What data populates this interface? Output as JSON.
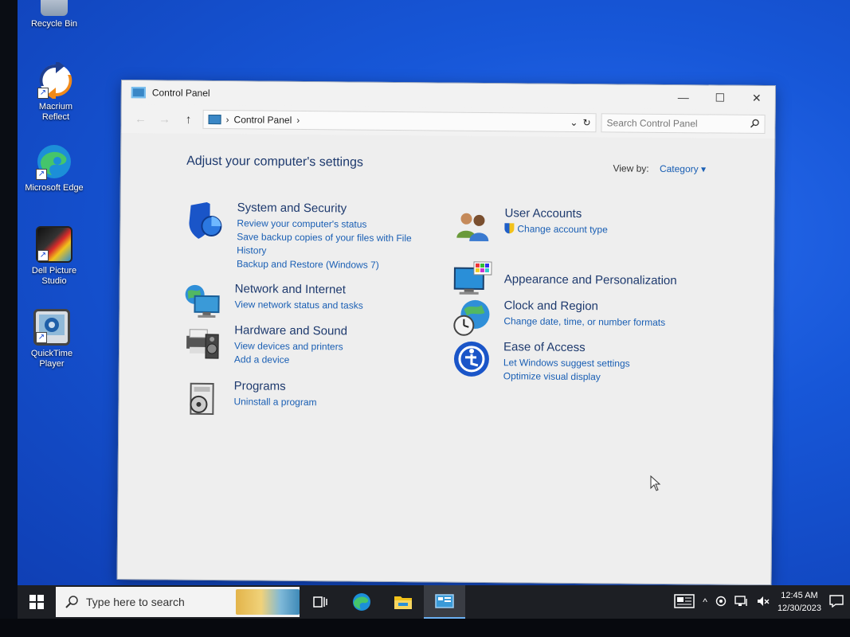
{
  "desktop": {
    "icons": [
      {
        "label": "Recycle Bin"
      },
      {
        "label": "Macrium Reflect"
      },
      {
        "label": "Microsoft Edge"
      },
      {
        "label": "Dell Picture Studio"
      },
      {
        "label": "QuickTime Player"
      }
    ]
  },
  "window": {
    "title": "Control Panel",
    "controls": {
      "minimize": "—",
      "maximize": "☐",
      "close": "✕"
    },
    "address": {
      "crumb": "Control Panel"
    },
    "search": {
      "placeholder": "Search Control Panel"
    },
    "heading": "Adjust your computer's settings",
    "view_by": {
      "label": "View by:",
      "value": "Category"
    },
    "categories_left": [
      {
        "title": "System and Security",
        "icon": "shield-icon",
        "links": [
          "Review your computer's status",
          "Save backup copies of your files with File History",
          "Backup and Restore (Windows 7)"
        ]
      },
      {
        "title": "Network and Internet",
        "icon": "network-icon",
        "links": [
          "View network status and tasks"
        ]
      },
      {
        "title": "Hardware and Sound",
        "icon": "printer-speaker-icon",
        "links": [
          "View devices and printers",
          "Add a device"
        ]
      },
      {
        "title": "Programs",
        "icon": "programs-icon",
        "links": [
          "Uninstall a program"
        ]
      }
    ],
    "categories_right": [
      {
        "title": "User Accounts",
        "icon": "users-icon",
        "links": [
          "Change account type"
        ]
      },
      {
        "title": "Appearance and Personalization",
        "icon": "monitor-palette-icon",
        "links": []
      },
      {
        "title": "Clock and Region",
        "icon": "globe-clock-icon",
        "links": [
          "Change date, time, or number formats"
        ]
      },
      {
        "title": "Ease of Access",
        "icon": "ease-of-access-icon",
        "links": [
          "Let Windows suggest settings",
          "Optimize visual display"
        ]
      }
    ]
  },
  "taskbar": {
    "search_placeholder": "Type here to search",
    "clock": {
      "time": "12:45 AM",
      "date": "12/30/2023"
    }
  },
  "colors": {
    "link": "#1a5fb4",
    "heading": "#1e3a6e",
    "desktop": "#1757d8",
    "taskbar": "#1d1f24"
  }
}
